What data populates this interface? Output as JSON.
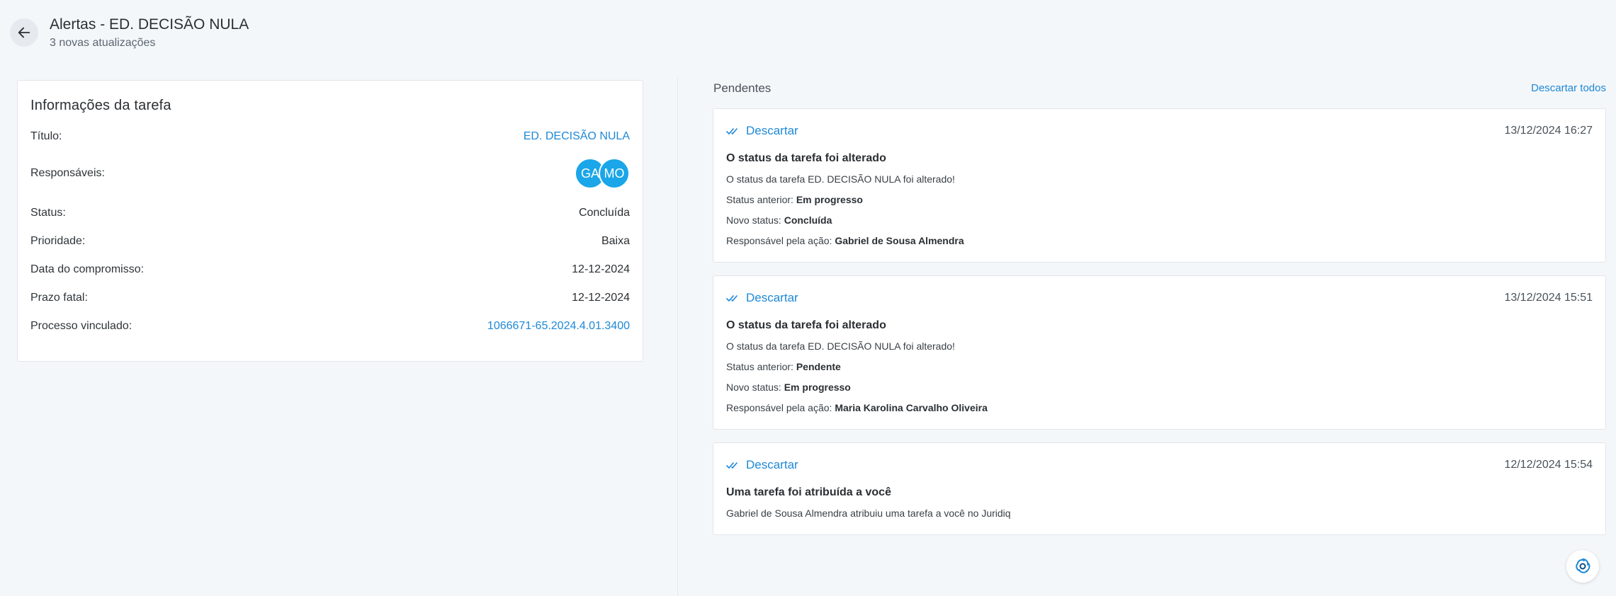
{
  "header": {
    "title": "Alertas - ED. DECISÃO NULA",
    "subtitle": "3 novas atualizações"
  },
  "task_info": {
    "heading": "Informações da tarefa",
    "rows": {
      "title": {
        "label": "Título:",
        "value": "ED. DECISÃO NULA"
      },
      "responsibles": {
        "label": "Responsáveis:",
        "avatars": [
          "GA",
          "MO"
        ]
      },
      "status": {
        "label": "Status:",
        "value": "Concluída"
      },
      "priority": {
        "label": "Prioridade:",
        "value": "Baixa"
      },
      "commitment_date": {
        "label": "Data do compromisso:",
        "value": "12-12-2024"
      },
      "deadline": {
        "label": "Prazo fatal:",
        "value": "12-12-2024"
      },
      "linked_process": {
        "label": "Processo vinculado:",
        "value": "1066671-65.2024.4.01.3400"
      }
    }
  },
  "pending": {
    "label": "Pendentes",
    "dismiss_all": "Descartar todos",
    "alerts": [
      {
        "dismiss": "Descartar",
        "date": "13/12/2024 16:27",
        "title": "O status da tarefa foi alterado",
        "message": "O status da tarefa ED. DECISÃO NULA foi alterado!",
        "prev_label": "Status anterior:",
        "prev_value": "Em progresso",
        "new_label": "Novo status:",
        "new_value": "Concluída",
        "resp_label": "Responsável pela ação:",
        "resp_value": "Gabriel de Sousa Almendra"
      },
      {
        "dismiss": "Descartar",
        "date": "13/12/2024 15:51",
        "title": "O status da tarefa foi alterado",
        "message": "O status da tarefa ED. DECISÃO NULA foi alterado!",
        "prev_label": "Status anterior:",
        "prev_value": "Pendente",
        "new_label": "Novo status:",
        "new_value": "Em progresso",
        "resp_label": "Responsável pela ação:",
        "resp_value": "Maria Karolina Carvalho Oliveira"
      },
      {
        "dismiss": "Descartar",
        "date": "12/12/2024 15:54",
        "title": "Uma tarefa foi atribuída a você",
        "message": "Gabriel de Sousa Almendra atribuiu uma tarefa a você no Juridiq"
      }
    ]
  },
  "colors": {
    "accent": "#1e88d6",
    "avatar": "#1aa6e8",
    "background": "#f4f7fa"
  },
  "icons": {
    "back": "arrow-left-icon",
    "dismiss": "double-check-icon",
    "assistant": "assistant-swirl-icon"
  }
}
